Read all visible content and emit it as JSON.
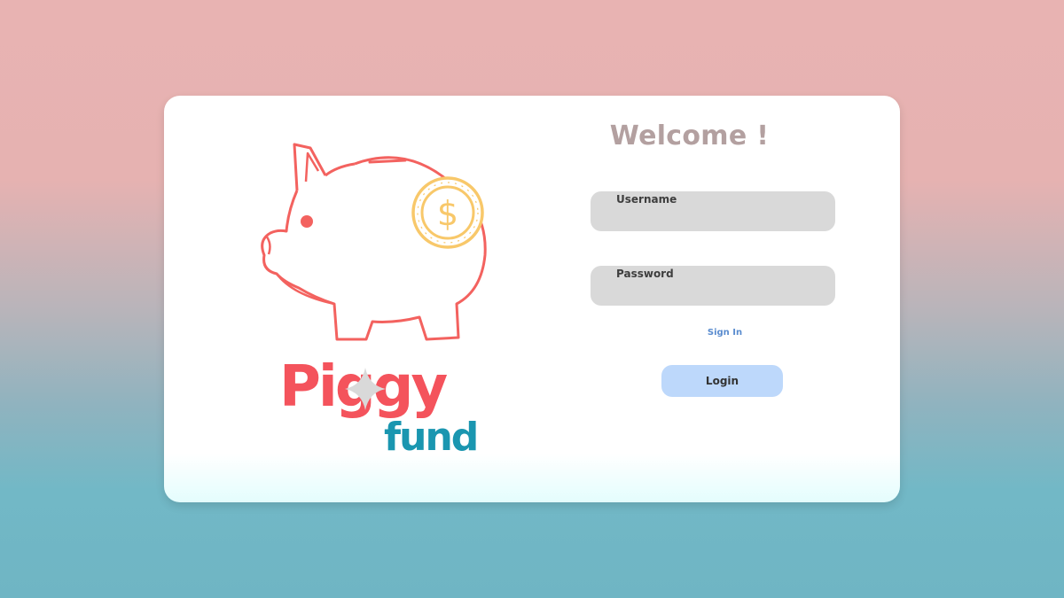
{
  "brand": {
    "name_primary": "Piggy",
    "name_secondary": "fund",
    "coin_symbol": "$",
    "colors": {
      "pig_outline": "#f3625f",
      "coin": "#f8c86a",
      "logo_red": "#f4535c",
      "logo_teal": "#1a96b0"
    }
  },
  "login": {
    "heading": "Welcome !",
    "username_label": "Username",
    "password_label": "Password",
    "signin_link": "Sign In",
    "login_button": "Login"
  },
  "colors": {
    "background_top": "#e8b3b2",
    "background_bottom": "#6fb5c4",
    "heading": "#b3a0a0",
    "field_bg": "#d9d9d9",
    "link": "#5a8ccf",
    "button_bg": "#bdd8fb"
  }
}
